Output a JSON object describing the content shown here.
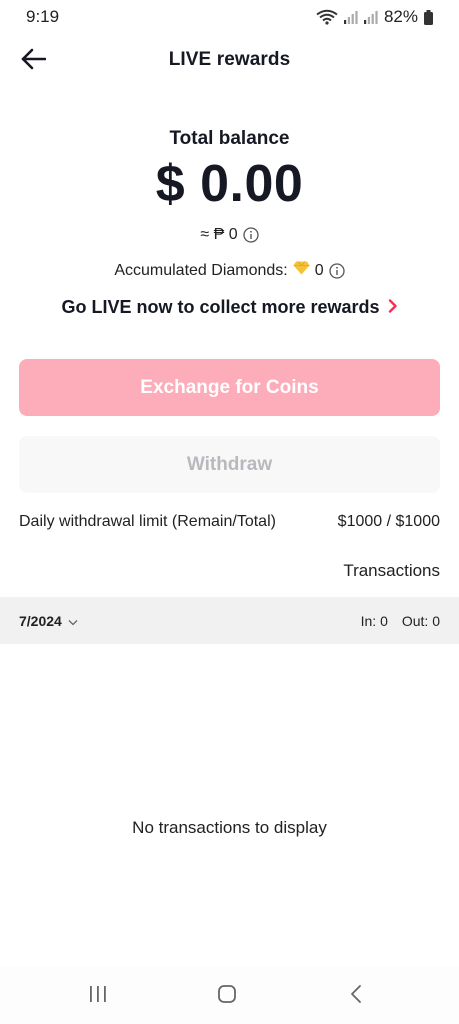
{
  "status_bar": {
    "time": "9:19",
    "battery": "82%"
  },
  "header": {
    "title": "LIVE rewards"
  },
  "balance": {
    "label": "Total balance",
    "amount": "$ 0.00",
    "php_equivalent": "≈ ₱ 0"
  },
  "diamonds": {
    "label": "Accumulated Diamonds:",
    "value": "0"
  },
  "go_live": {
    "label": "Go LIVE now to collect more rewards"
  },
  "buttons": {
    "exchange": "Exchange for Coins",
    "withdraw": "Withdraw"
  },
  "withdrawal_limit": {
    "label": "Daily withdrawal limit (Remain/Total)",
    "value": "$1000 / $1000"
  },
  "transactions": {
    "link": "Transactions",
    "month": "7/2024",
    "in": "In: 0",
    "out": "Out: 0",
    "empty": "No transactions to display"
  },
  "colors": {
    "accent": "#fe2c55",
    "exchange_button": "#fdacb9",
    "withdraw_button": "#f8f8f8",
    "diamond": "#f5c33b"
  },
  "icons": {
    "back": "arrow-left-icon",
    "info": "info-circle-icon",
    "diamond": "diamond-icon",
    "chevron_right": "chevron-right-icon",
    "chevron_down": "chevron-down-icon",
    "nav_recents": "recents-icon",
    "nav_home": "home-icon",
    "nav_back": "back-icon"
  }
}
